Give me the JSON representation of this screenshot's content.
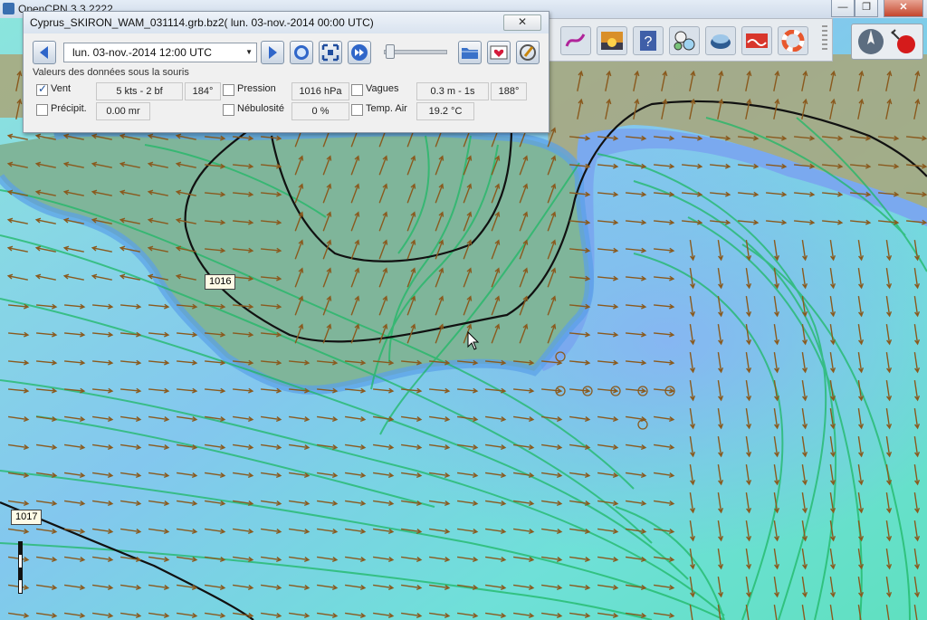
{
  "app": {
    "title": "OpenCPN 3.3.2222"
  },
  "window_controls": {
    "minimize": "—",
    "maximize": "❐",
    "close": "✕"
  },
  "toolbar": {
    "buttons": [
      {
        "name": "route-tool",
        "icon": "route-icon"
      },
      {
        "name": "sunset-tool",
        "icon": "sunset-icon"
      },
      {
        "name": "help-tool",
        "icon": "help-icon"
      },
      {
        "name": "instruments-tool",
        "icon": "gauge-icon"
      },
      {
        "name": "chart-info-tool",
        "icon": "chart-info-icon"
      },
      {
        "name": "tide-tool",
        "icon": "tide-icon"
      },
      {
        "name": "lifebuoy-tool",
        "icon": "lifebuoy-icon"
      }
    ]
  },
  "grib": {
    "title": "Cyprus_SKIRON_WAM_031114.grb.bz2( lun. 03-nov.-2014 00:00  UTC)",
    "close": "✕",
    "time_value": "lun. 03-nov.-2014 12:00  UTC",
    "group_label": "Valeurs des données sous la souris",
    "wind": {
      "label": "Vent",
      "checked": true,
      "speed": "5 kts -  2 bf",
      "dir": "184°"
    },
    "pressure": {
      "label": "Pression",
      "checked": false,
      "value": "1016 hPa"
    },
    "waves": {
      "label": "Vagues",
      "checked": false,
      "value": "0.3 m - 1s",
      "dir": "188°"
    },
    "precip": {
      "label": "Précipit.",
      "checked": false,
      "value": "0.00 mr"
    },
    "cloud": {
      "label": "Nébulosité",
      "checked": false,
      "value": "0 %"
    },
    "air_temp": {
      "label": "Temp. Air",
      "checked": false,
      "value": "19.2 °C"
    }
  },
  "isobars": {
    "label_a": "1016",
    "label_b": "1017"
  },
  "colors": {
    "land": "#7fb59a",
    "sea_light": "#7fe3df",
    "sea_blue": "#7fb2ee",
    "arrow": "#8a5a1e",
    "isobar": "#111111",
    "streamline": "#22c06a"
  }
}
